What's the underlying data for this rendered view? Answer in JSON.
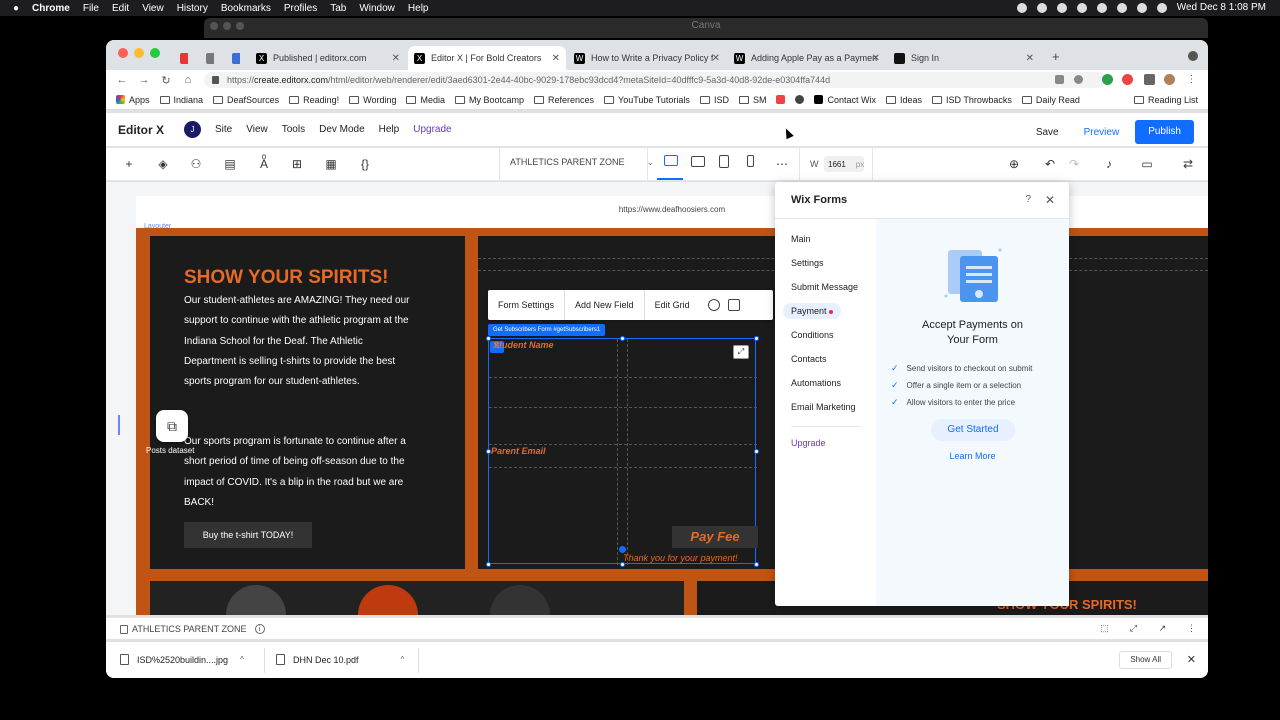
{
  "menubar": {
    "app": "Chrome",
    "items": [
      "File",
      "Edit",
      "View",
      "History",
      "Bookmarks",
      "Profiles",
      "Tab",
      "Window",
      "Help"
    ],
    "clock": "Wed Dec 8  1:08 PM"
  },
  "background_window": {
    "title": "Canva"
  },
  "tabs": [
    {
      "title": "Published | editorx.com",
      "favicon": "X",
      "color": "#000000"
    },
    {
      "title": "Editor X | For Bold Creators",
      "favicon": "X",
      "color": "#000000"
    },
    {
      "title": "How to Write a Privacy Policy f",
      "favicon": "W",
      "color": "#000000"
    },
    {
      "title": "Adding Apple Pay as a Paymen",
      "favicon": "W",
      "color": "#000000"
    },
    {
      "title": "Sign In",
      "favicon": "■",
      "color": "#111111"
    }
  ],
  "address_bar": {
    "scheme": "https://",
    "host": "create.editorx.com",
    "path": "/html/editor/web/renderer/edit/3aed6301-2e44-40bc-9029-178ebc93dcd4?metaSiteId=40dfffc9-5a3d-40d8-92de-e0304ffa744d"
  },
  "bookmarks": [
    {
      "label": "Apps",
      "icon": "apps-grid-icon"
    },
    {
      "label": "Indiana",
      "icon": "folder-icon"
    },
    {
      "label": "DeafSources",
      "icon": "folder-icon"
    },
    {
      "label": "Reading!",
      "icon": "folder-icon"
    },
    {
      "label": "Wording",
      "icon": "folder-icon"
    },
    {
      "label": "Media",
      "icon": "folder-icon"
    },
    {
      "label": "My Bootcamp",
      "icon": "folder-icon"
    },
    {
      "label": "References",
      "icon": "folder-icon"
    },
    {
      "label": "YouTube Tutorials",
      "icon": "folder-icon"
    },
    {
      "label": "ISD",
      "icon": "folder-icon"
    },
    {
      "label": "SM",
      "icon": "folder-icon"
    },
    {
      "label": "Contact Wix",
      "icon": "wix-icon"
    },
    {
      "label": "Ideas",
      "icon": "folder-icon"
    },
    {
      "label": "ISD Throwbacks",
      "icon": "folder-icon"
    },
    {
      "label": "Daily Read",
      "icon": "folder-icon"
    }
  ],
  "reading_list": "Reading List",
  "editor": {
    "brand": "Editor X",
    "avatar": "J",
    "menu": [
      "Site",
      "View",
      "Tools",
      "Dev Mode",
      "Help"
    ],
    "upgrade": "Upgrade",
    "save": "Save",
    "preview": "Preview",
    "publish": "Publish",
    "page_selector": "ATHLETICS PARENT ZONE",
    "width_label": "W",
    "width_value": "1661",
    "width_unit": "px"
  },
  "site": {
    "url": "https://www.deafhoosiers.com",
    "layouter_label": "Layouter",
    "heading": "SHOW YOUR SPIRITS!",
    "para1": "Our student-athletes are AMAZING! They need our support to continue with the athletic program at the Indiana School for the Deaf. The Athletic Department is selling t-shirts to provide the best sports program for our student-athletes.",
    "para2": "Our sports program is fortunate to continue after a short period of time of being off-season due to the impact of COVID. It's a blip in the road but we are BACK!",
    "cta": "Buy the t-shirt TODAY!",
    "posts_label": "Posts dataset",
    "heading2": "SHOW YOUR SPIRITS!",
    "accent_color": "#e66a25"
  },
  "form_toolbar": {
    "settings": "Form Settings",
    "add_field": "Add New Field",
    "edit_grid": "Edit Grid",
    "tag": "Get Subscribers Form #getSubscribers1"
  },
  "form": {
    "field_name": "Student Name",
    "field_email": "Parent Email",
    "pay_button": "Pay Fee",
    "thanks": "Thank you for your payment!"
  },
  "wix_forms": {
    "title": "Wix Forms",
    "help": "?",
    "nav": [
      "Main",
      "Settings",
      "Submit Message",
      "Payment",
      "Conditions",
      "Contacts",
      "Automations",
      "Email Marketing"
    ],
    "nav_upgrade": "Upgrade",
    "active": "Payment",
    "heading_line1": "Accept Payments on",
    "heading_line2": "Your Form",
    "features": [
      "Send visitors to checkout on submit",
      "Offer a single item or a selection",
      "Allow visitors to enter the price"
    ],
    "get_started": "Get Started",
    "learn_more": "Learn More"
  },
  "editor_bottom": {
    "page_label": "ATHLETICS PARENT ZONE"
  },
  "downloads": [
    {
      "name": "ISD%2520buildin....jpg"
    },
    {
      "name": "DHN Dec 10.pdf"
    }
  ],
  "show_all": "Show All"
}
